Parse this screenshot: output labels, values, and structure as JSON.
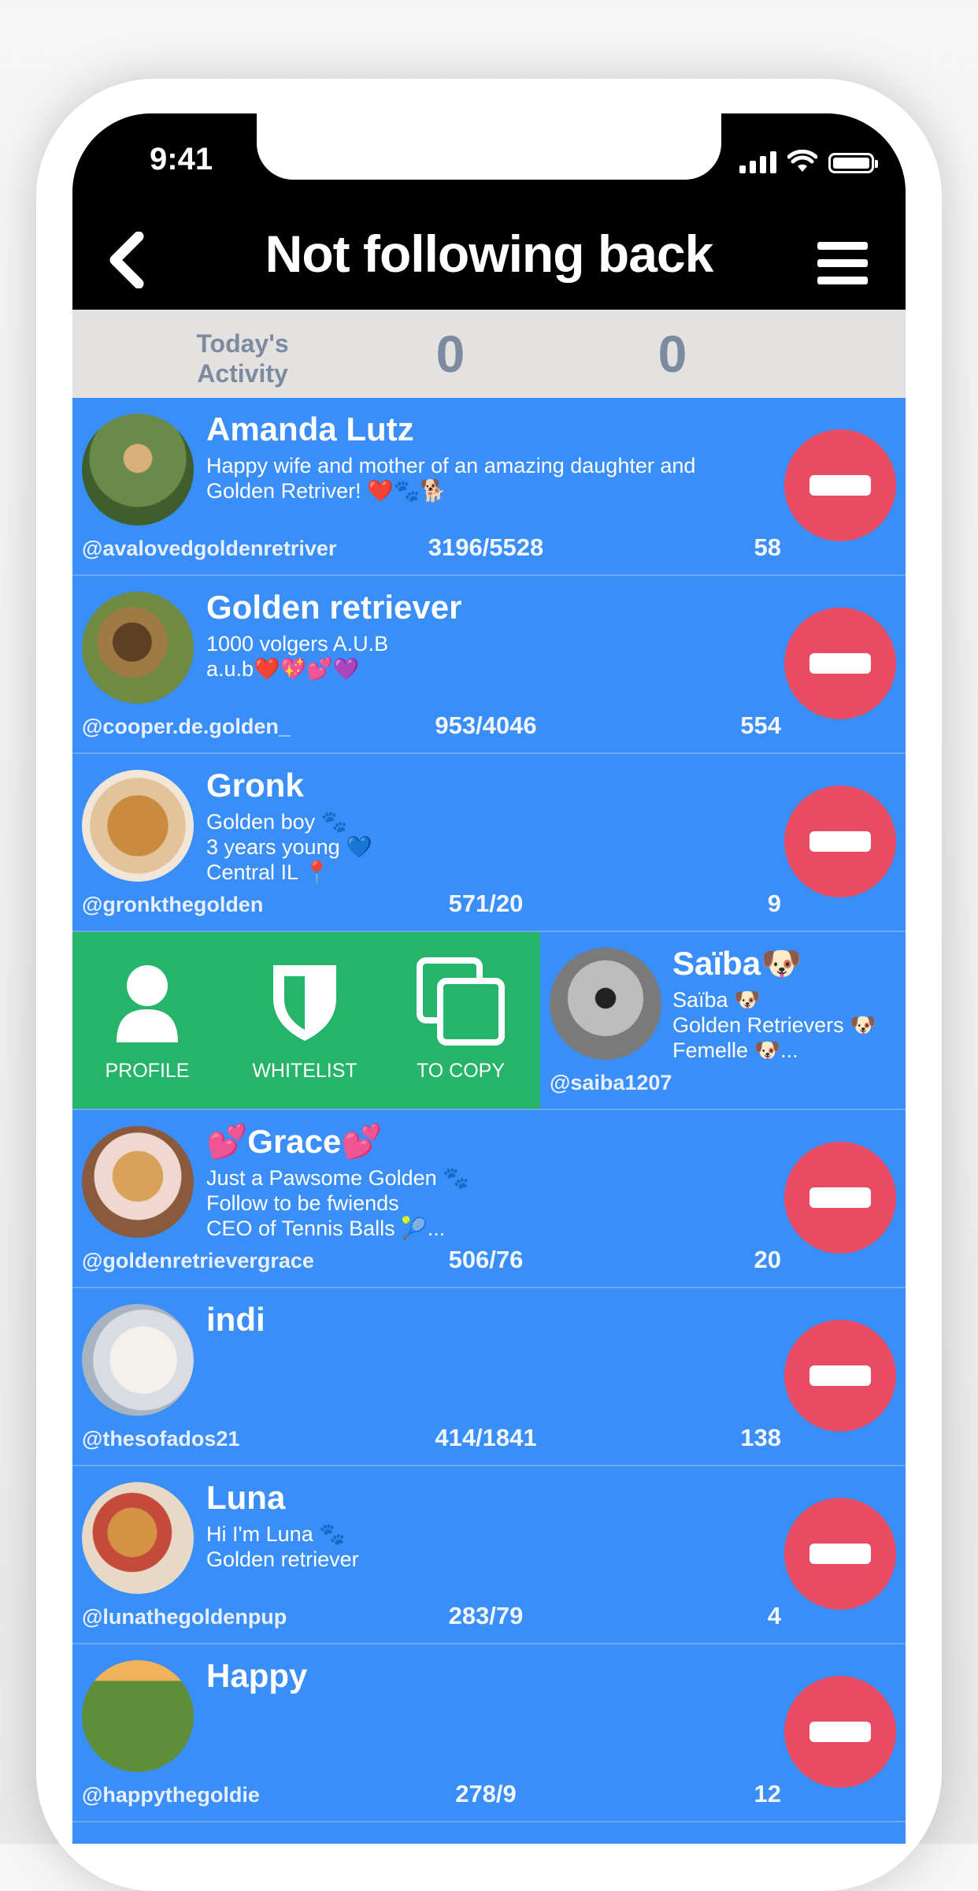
{
  "status_bar": {
    "time": "9:41"
  },
  "nav": {
    "title": "Not following back"
  },
  "activity": {
    "label": "Today's\nActivity",
    "value_1": "0",
    "value_2": "0"
  },
  "rows": [
    {
      "name": "Amanda Lutz",
      "bio": "Happy wife and mother of an amazing daughter and\nGolden Retriver! ❤️🐾🐕",
      "handle": "@avalovedgoldenretriver",
      "ratio": "3196/5528",
      "count": "58"
    },
    {
      "name": "Golden retriever",
      "bio": "1000 volgers A.U.B\na.u.b❤️💖💕💜",
      "handle": "@cooper.de.golden_",
      "ratio": "953/4046",
      "count": "554"
    },
    {
      "name": "Gronk",
      "bio": "Golden boy 🐾\n3 years young 💙\nCentral IL 📍",
      "handle": "@gronkthegolden",
      "ratio": "571/20",
      "count": "9"
    },
    {
      "name": "Saïba🐶",
      "bio": "Saïba 🐶\nGolden Retrievers 🐶\nFemelle 🐶...",
      "handle": "@saiba1207"
    },
    {
      "name": "💕Grace💕",
      "bio": "Just a Pawsome Golden 🐾\nFollow to be fwiends\nCEO of Tennis Balls 🎾...",
      "handle": "@goldenretrievergrace",
      "ratio": "506/76",
      "count": "20"
    },
    {
      "name": "indi",
      "bio": "",
      "handle": "@thesofados21",
      "ratio": "414/1841",
      "count": "138"
    },
    {
      "name": "Luna",
      "bio": "Hi I'm Luna 🐾\nGolden retriever",
      "handle": "@lunathegoldenpup",
      "ratio": "283/79",
      "count": "4"
    },
    {
      "name": "Happy",
      "bio": "",
      "handle": "@happythegoldie",
      "ratio": "278/9",
      "count": "12"
    }
  ],
  "swipe_actions": {
    "profile": "PROFILE",
    "whitelist": "WHITELIST",
    "copy": "TO COPY"
  },
  "colors": {
    "row_bg": "#3a8ef7",
    "remove": "#e84b62",
    "swipe_bg": "#25b46a",
    "activity_bg": "#e4e1e1"
  }
}
